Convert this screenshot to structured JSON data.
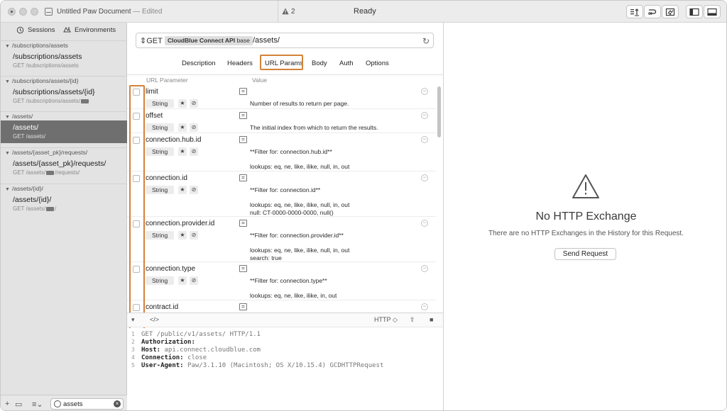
{
  "titlebar": {
    "document_title": "Untitled Paw Document",
    "edited_suffix": " — Edited",
    "warning_count": "2",
    "status": "Ready"
  },
  "sidebar": {
    "tabs": [
      {
        "label": "Sessions",
        "icon": "history-icon"
      },
      {
        "label": "Environments",
        "icon": "environments-icon"
      }
    ],
    "groups": [
      {
        "label": "/subscriptions/assets",
        "items": [
          {
            "name": "/subscriptions/assets",
            "sub": "GET /subscriptions/assets"
          }
        ]
      },
      {
        "label": "/subscriptions/assets/{id}",
        "items": [
          {
            "name": "/subscriptions/assets/{id}",
            "sub_prefix": "GET /subscriptions/assets/",
            "sub_suffix": ""
          }
        ]
      },
      {
        "label": "/assets/",
        "items": [
          {
            "name": "/assets/",
            "sub": "GET /assets/"
          }
        ]
      },
      {
        "label": "/assets/{asset_pk}/requests/",
        "items": [
          {
            "name": "/assets/{asset_pk}/requests/",
            "sub_prefix": "GET /assets/",
            "sub_suffix": "/requests/"
          }
        ]
      },
      {
        "label": "/assets/{id}/",
        "items": [
          {
            "name": "/assets/{id}/",
            "sub_prefix": "GET /assets/",
            "sub_suffix": "/"
          }
        ]
      }
    ],
    "filter": {
      "value": "assets"
    }
  },
  "request": {
    "method": "GET",
    "base_name": "CloudBlue Connect API",
    "base_suffix": "base",
    "path": "/assets/",
    "tabs": [
      "Description",
      "Headers",
      "URL Params",
      "Body",
      "Auth",
      "Options"
    ],
    "active_tab": "URL Params",
    "params_header": {
      "name": "URL Parameter",
      "value": "Value"
    },
    "params": [
      {
        "name": "limit",
        "type": "String",
        "desc": "Number of results to return per page."
      },
      {
        "name": "offset",
        "type": "String",
        "desc": "The initial index from which to return the results."
      },
      {
        "name": "connection.hub.id",
        "type": "String",
        "desc": "**Filter for: connection.hub.id**\n\nlookups: eq, ne, like, ilike, null, in, out"
      },
      {
        "name": "connection.id",
        "type": "String",
        "desc": "**Filter for: connection.id**\n\nlookups: eq, ne, like, ilike, null, in, out\nnull: CT-0000-0000-0000, null()"
      },
      {
        "name": "connection.provider.id",
        "type": "String",
        "desc": "**Filter for: connection.provider.id**\n\nlookups: eq, ne, like, ilike, null, in, out\nsearch: true"
      },
      {
        "name": "connection.type",
        "type": "String",
        "desc": "**Filter for: connection.type**\n\nlookups: eq, ne, like, ilike, in, out"
      },
      {
        "name": "contract.id",
        "type": "String",
        "desc": ""
      }
    ]
  },
  "code_toolbar": {
    "format": "HTTP ◇"
  },
  "code": [
    {
      "ln": "1",
      "text": "GET /public/v1/assets/ HTTP/1.1"
    },
    {
      "ln": "2",
      "key": "Authorization:",
      "val": ""
    },
    {
      "ln": "3",
      "key": "Host:",
      "val": " api.connect.cloudblue.com"
    },
    {
      "ln": "4",
      "key": "Connection:",
      "val": " close"
    },
    {
      "ln": "5",
      "key": "User-Agent:",
      "val": " Paw/3.1.10 (Macintosh; OS X/10.15.4) GCDHTTPRequest"
    }
  ],
  "exchange": {
    "title": "No HTTP Exchange",
    "subtitle": "There are no HTTP Exchanges in the History for this Request.",
    "send_label": "Send Request"
  },
  "colors": {
    "highlight": "#d4823a",
    "selected_row": "#6f6f6f"
  }
}
